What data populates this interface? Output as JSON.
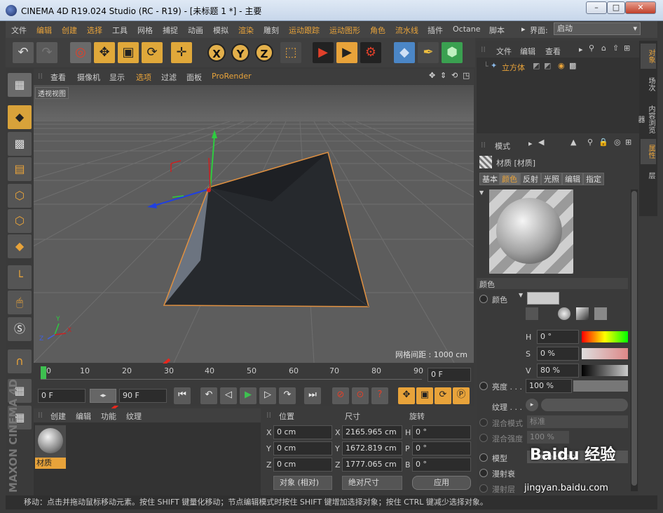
{
  "window": {
    "title": "CINEMA 4D R19.024 Studio (RC - R19) - [未标题 1 *] - 主要",
    "minimize": "–",
    "maximize": "□",
    "close": "✕"
  },
  "menu": {
    "items": [
      "文件",
      "编辑",
      "创建",
      "选择",
      "工具",
      "网格",
      "捕捉",
      "动画",
      "模拟",
      "渲染",
      "雕刻",
      "运动跟踪",
      "运动图形",
      "角色",
      "流水线",
      "插件",
      "Octane",
      "脚本"
    ],
    "interface_label": "界面:",
    "interface_value": "启动"
  },
  "toolbar": {
    "axis_x": "X",
    "axis_y": "Y",
    "axis_z": "Z"
  },
  "viewport": {
    "menu": [
      "查看",
      "摄像机",
      "显示",
      "选项",
      "过滤",
      "面板",
      "ProRender"
    ],
    "label": "透视视图",
    "grid_spacing": "网格间距 : 1000 cm",
    "axis_x": "X",
    "axis_y": "Y",
    "axis_z": "Z"
  },
  "timeline": {
    "ticks": [
      "0",
      "10",
      "20",
      "30",
      "40",
      "50",
      "60",
      "70",
      "80",
      "90"
    ],
    "current_frame": "0 F",
    "start_frame": "0 F",
    "end_frame": "90 F"
  },
  "material_manager": {
    "menu": [
      "创建",
      "编辑",
      "功能",
      "纹理"
    ],
    "material_name": "材质"
  },
  "coordinates": {
    "headers": [
      "位置",
      "尺寸",
      "旋转"
    ],
    "rows": [
      {
        "axis": "X",
        "pos": "0 cm",
        "size_axis": "X",
        "size": "2165.965 cm",
        "rot_axis": "H",
        "rot": "0 °"
      },
      {
        "axis": "Y",
        "pos": "0 cm",
        "size_axis": "Y",
        "size": "1672.819 cm",
        "rot_axis": "P",
        "rot": "0 °"
      },
      {
        "axis": "Z",
        "pos": "0 cm",
        "size_axis": "Z",
        "size": "1777.065 cm",
        "rot_axis": "B",
        "rot": "0 °"
      }
    ],
    "mode_object": "对象 (相对)",
    "mode_size": "绝对尺寸",
    "apply": "应用"
  },
  "object_manager": {
    "menu": [
      "文件",
      "编辑",
      "查看"
    ],
    "object_name": "立方体"
  },
  "attribute_manager": {
    "mode": "模式",
    "title": "材质 [材质]",
    "tabs": [
      "基本",
      "颜色",
      "反射",
      "光照",
      "编辑",
      "指定"
    ],
    "section": "颜色",
    "color_label": "颜色",
    "h_label": "H",
    "h_value": "0 °",
    "s_label": "S",
    "s_value": "0 %",
    "v_label": "V",
    "v_value": "80 %",
    "brightness_label": "亮度 . . .",
    "brightness_value": "100 %",
    "texture_label": "纹理 . . .",
    "blend_mode_label": "混合模式",
    "blend_mode_value": "标准",
    "blend_strength_label": "混合强度",
    "blend_strength_value": "100 %",
    "model_label": "模型",
    "model_value": "Lambertian",
    "diffuse1": "漫射衰",
    "diffuse2": "漫射层"
  },
  "right_tabs": [
    "对象",
    "场次",
    "内容浏览器",
    "属性",
    "层"
  ],
  "brand": "MAXON CINEMA 4D",
  "status": "移动：点击并拖动鼠标移动元素。按住 SHIFT 键量化移动；节点编辑模式时按住 SHIFT 键增加选择对象；按住 CTRL 键减少选择对象。",
  "watermark": {
    "text": "Baidu 经验",
    "url": "jingyan.baidu.com"
  },
  "colors": {
    "accent": "#e8a33a",
    "selection_outline": "#e09040",
    "annotation_arrow": "#e8271d"
  }
}
